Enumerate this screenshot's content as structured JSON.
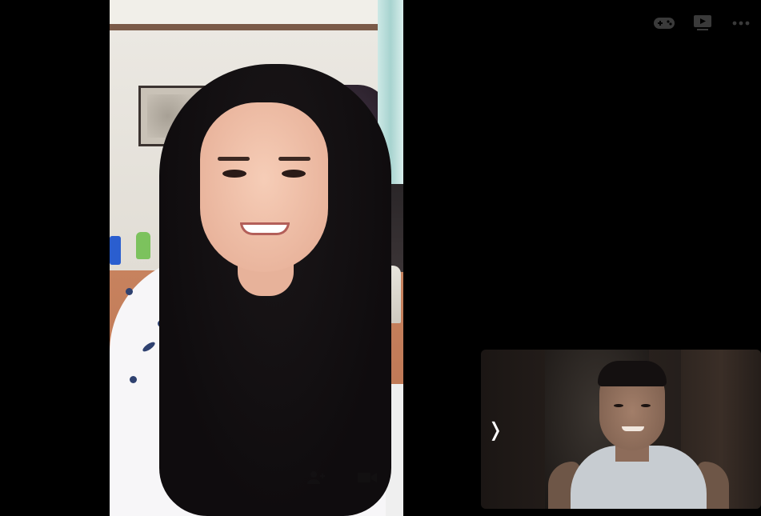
{
  "call": {
    "remote_video_label": "",
    "self_view_label": ""
  },
  "top_controls": [
    {
      "name": "games-icon",
      "label": ""
    },
    {
      "name": "watch-together-icon",
      "label": ""
    },
    {
      "name": "more-options-icon",
      "label": ""
    }
  ],
  "self_view": {
    "collapse_glyph": "❭"
  },
  "colors": {
    "background": "#000000",
    "control_icon": "#3a3a3a"
  }
}
